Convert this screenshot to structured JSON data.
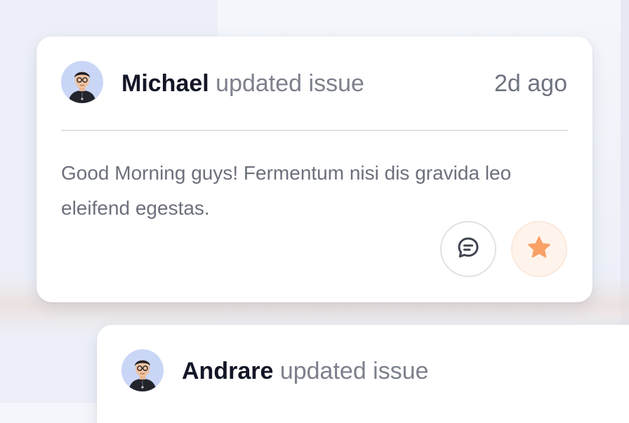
{
  "feed": [
    {
      "user": "Michael",
      "action": "updated issue",
      "time": "2d ago",
      "message": "Good Morning guys! Fermentum nisi dis gravida leo eleifend egestas.",
      "comment_icon": "chat-bubble-icon",
      "star_icon": "star-icon",
      "star_color": "#f9a066"
    },
    {
      "user": "Andrare",
      "action": "updated issue"
    }
  ]
}
